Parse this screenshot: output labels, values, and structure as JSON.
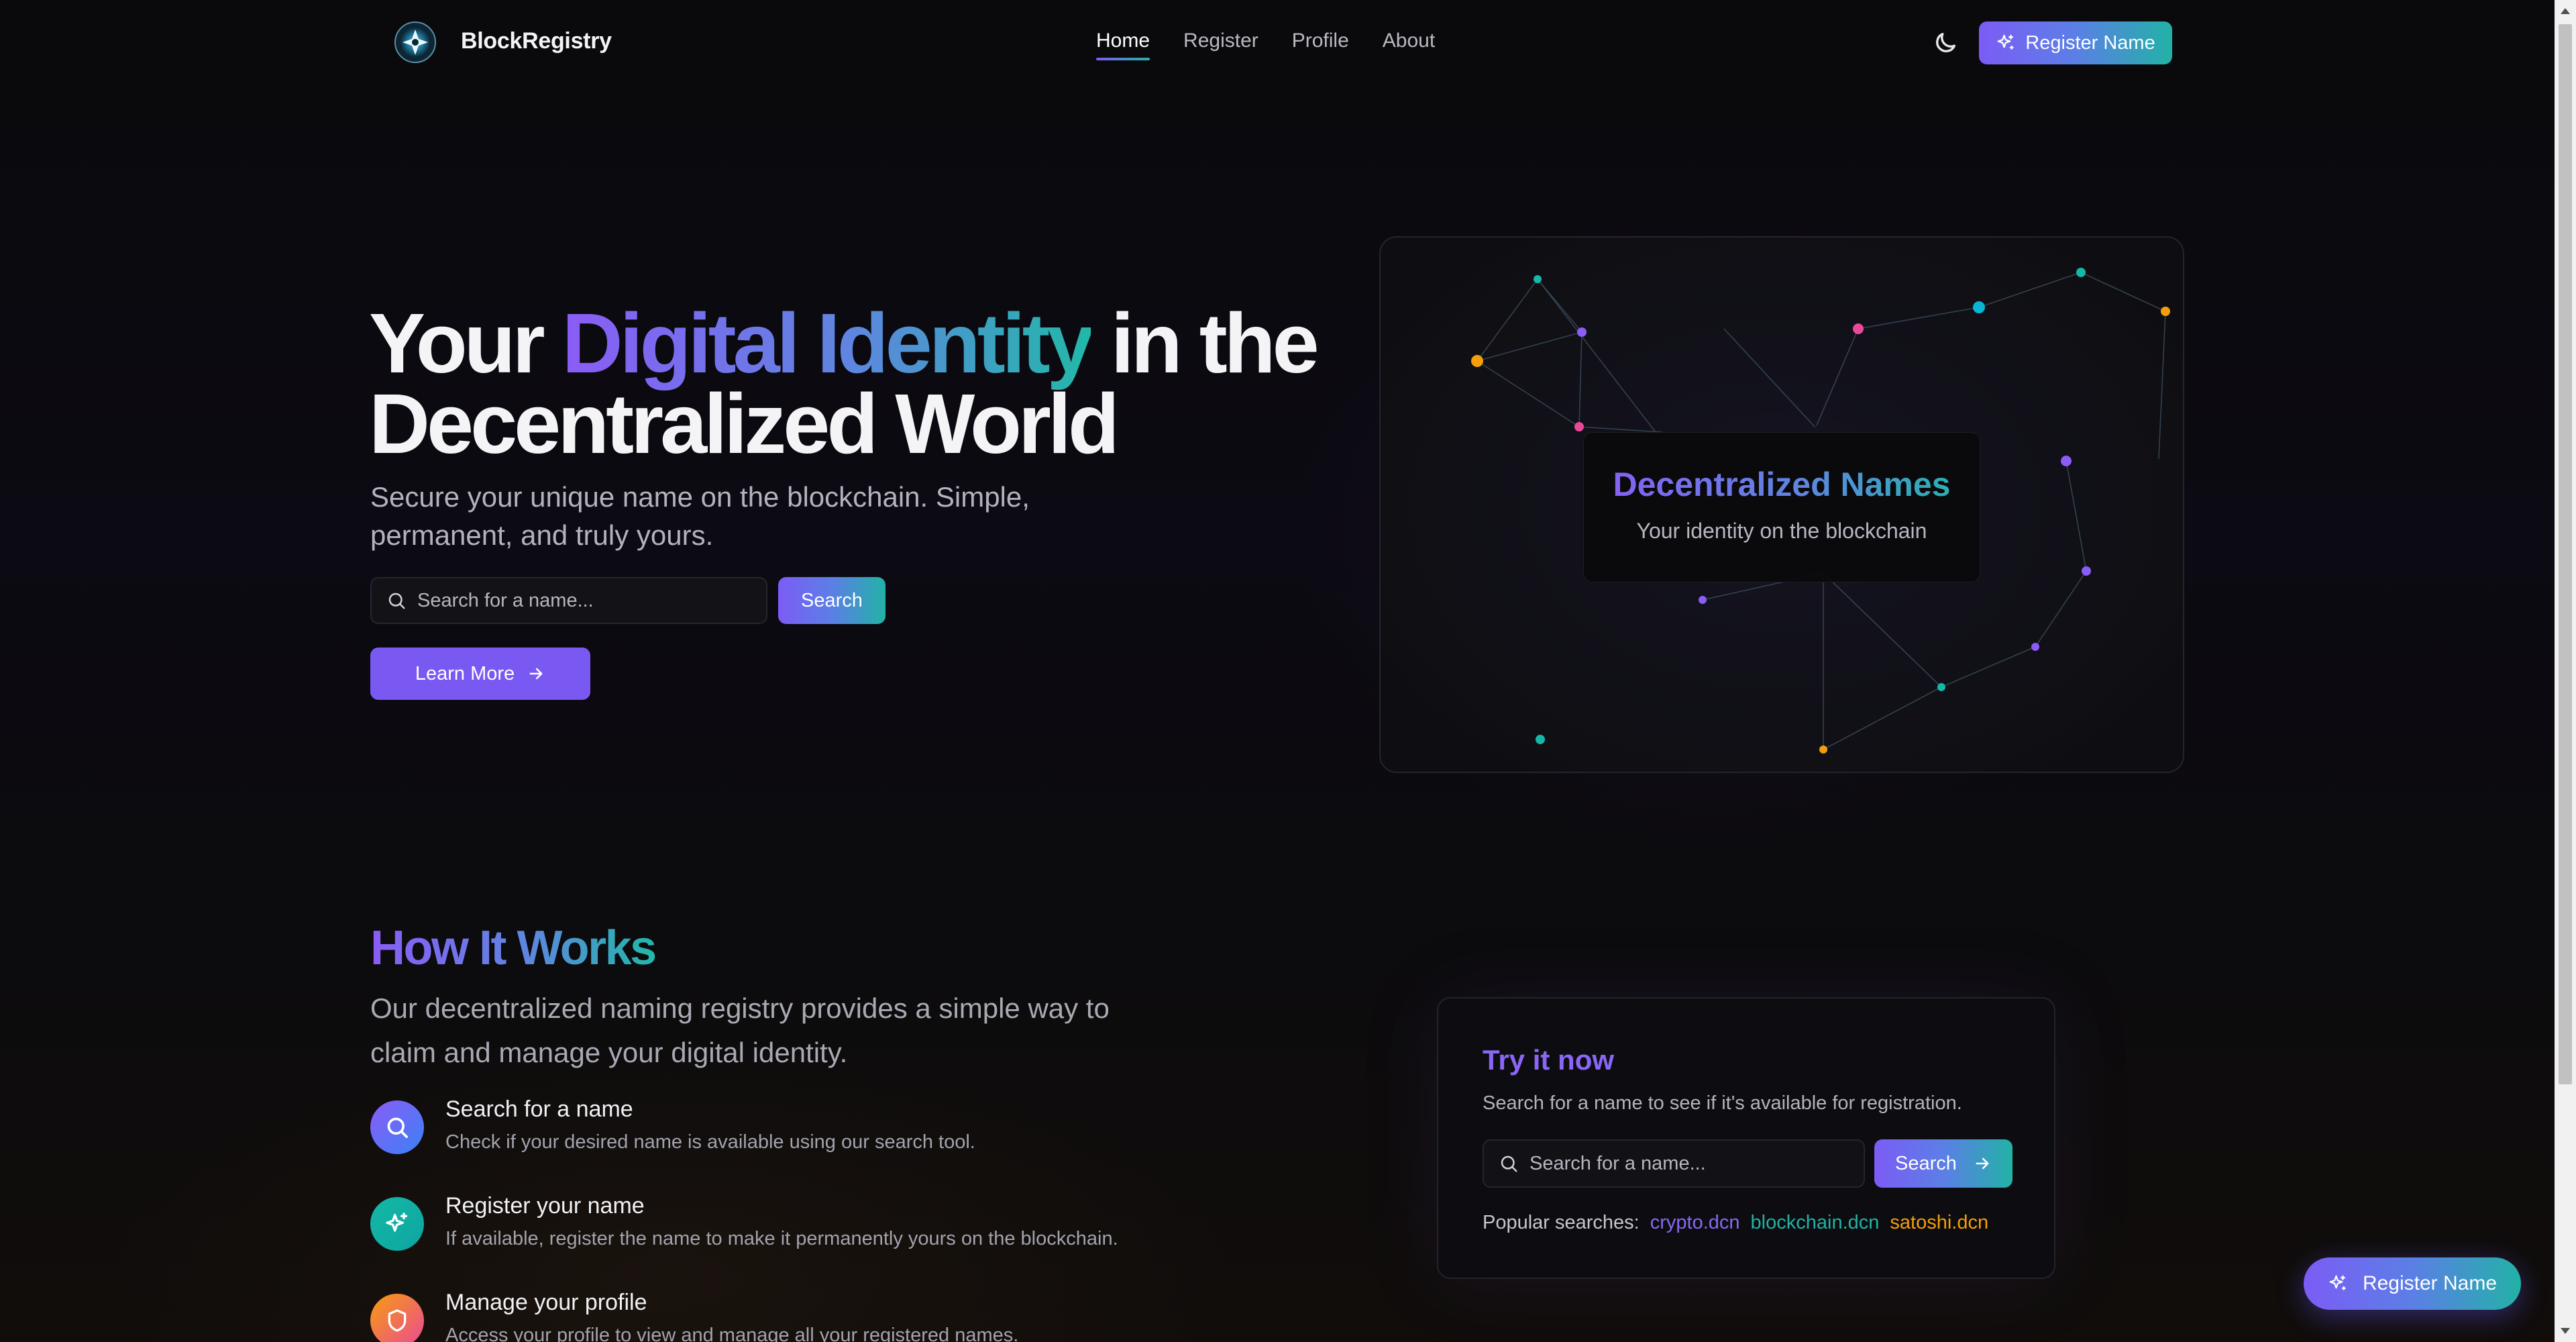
{
  "header": {
    "brand": "BlockRegistry",
    "nav": [
      {
        "label": "Home",
        "active": true
      },
      {
        "label": "Register"
      },
      {
        "label": "Profile"
      },
      {
        "label": "About"
      }
    ],
    "theme_icon": "moon-icon",
    "cta_label": "Register Name",
    "cta_icon": "sparkles-icon"
  },
  "hero": {
    "title_part1": "Your ",
    "title_highlight": "Digital Identity",
    "title_part2": " in the",
    "title_line2": "Decentralized World",
    "subtitle": "Secure your unique name on the blockchain. Simple, permanent, and truly yours.",
    "search_placeholder": "Search for a name...",
    "search_button": "Search",
    "learn_more": "Learn More"
  },
  "network_card": {
    "title": "Decentralized Names",
    "subtitle": "Your identity on the blockchain"
  },
  "how_it_works": {
    "title": "How It Works",
    "subtitle": "Our decentralized naming registry provides a simple way to claim and manage your digital identity.",
    "steps": [
      {
        "title": "Search for a name",
        "desc": "Check if your desired name is available using our search tool.",
        "icon": "search-icon"
      },
      {
        "title": "Register your name",
        "desc": "If available, register the name to make it permanently yours on the blockchain.",
        "icon": "sparkles-icon"
      },
      {
        "title": "Manage your profile",
        "desc": "Access your profile to view and manage all your registered names.",
        "icon": "shield-icon"
      }
    ]
  },
  "try_it": {
    "title": "Try it now",
    "subtitle": "Search for a name to see if it's available for registration.",
    "placeholder": "Search for a name...",
    "button": "Search",
    "popular_label": "Popular searches:",
    "popular": [
      "crypto.dcn",
      "blockchain.dcn",
      "satoshi.dcn"
    ]
  },
  "floating_cta": "Register Name",
  "colors": {
    "accent_purple": "#7c5cf5",
    "accent_teal": "#22b2a6",
    "accent_orange": "#f59e0b",
    "accent_pink": "#ec4899"
  }
}
